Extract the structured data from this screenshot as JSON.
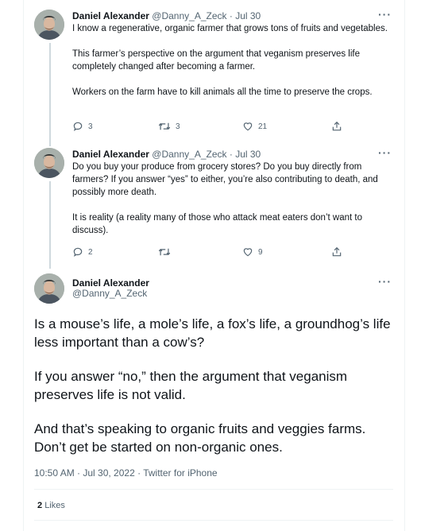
{
  "tweets": [
    {
      "author": "Daniel Alexander",
      "handle": "@Danny_A_Zeck",
      "sep": "·",
      "date": "Jul 30",
      "more": "···",
      "paragraphs": [
        "I know a regenerative, organic farmer that grows tons of fruits and vegetables.",
        "This farmer’s perspective on the argument that veganism preserves life completely changed after becoming a farmer.",
        "Workers on the farm have to kill animals all the time to preserve the crops."
      ],
      "replies": "3",
      "retweets": "3",
      "likes": "21"
    },
    {
      "author": "Daniel Alexander",
      "handle": "@Danny_A_Zeck",
      "sep": "·",
      "date": "Jul 30",
      "more": "···",
      "paragraphs": [
        "Do you buy your produce from grocery stores? Do you buy directly from farmers? If you answer “yes” to either, you’re also contributing to death, and possibly more death.",
        "It is reality (a reality many of those who attack meat eaters don’t want to discuss)."
      ],
      "replies": "2",
      "retweets": "",
      "likes": "9"
    }
  ],
  "main": {
    "author": "Daniel Alexander",
    "handle": "@Danny_A_Zeck",
    "more": "···",
    "paragraphs": [
      "Is a mouse’s life, a mole’s life, a fox’s life, a groundhog’s life less important than a cow’s?",
      "If you answer “no,” then the argument that veganism preserves life is not valid.",
      "And that’s speaking to organic fruits and veggies farms. Don’t get be started on non-organic ones."
    ],
    "timestamp": "10:50 AM · Jul 30, 2022 · Twitter for iPhone",
    "likes_count": "2",
    "likes_label": "Likes"
  },
  "icons": {
    "reply": "reply-icon",
    "retweet": "retweet-icon",
    "like": "heart-icon",
    "share": "share-icon"
  }
}
